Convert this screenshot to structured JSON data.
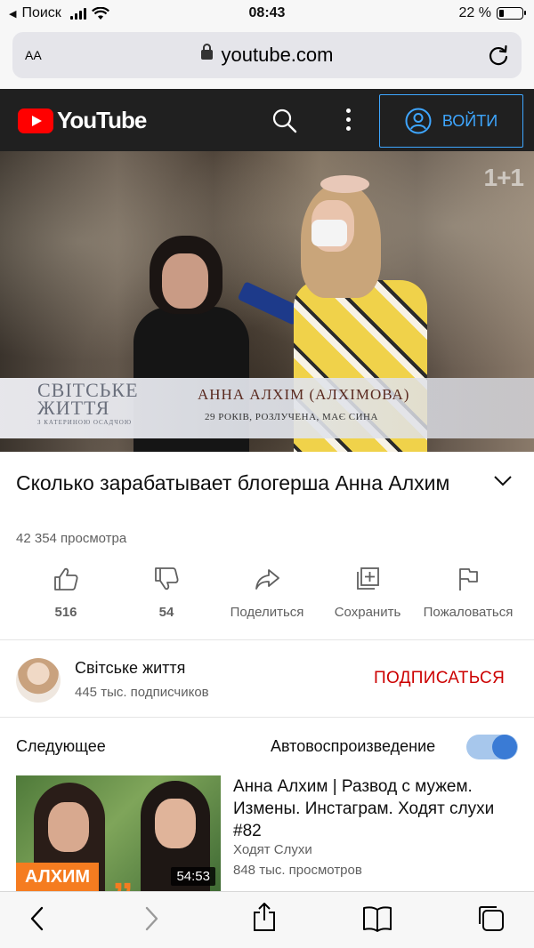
{
  "status_bar": {
    "back_label": "Поиск",
    "time": "08:43",
    "battery": "22 %",
    "battery_level": 0.22
  },
  "browser": {
    "text_size_label": "AA",
    "url": "youtube.com"
  },
  "header": {
    "logo_text": "YouTube",
    "signin_label": "ВОЙТИ",
    "accent_color": "#3ea6ff",
    "brand_color": "#ff0000"
  },
  "video": {
    "overlay": {
      "channel_watermark": "1+1",
      "show_name_line1": "СВІТСЬКЕ",
      "show_name_line2": "ЖИТТЯ",
      "show_name_line3": "З КАТЕРИНОЮ ОСАДЧОЮ",
      "guest_name": "АННА АЛХІМ (АЛХІМОВА)",
      "guest_info": "29 РОКІВ, РОЗЛУЧЕНА, МАЄ СИНА"
    },
    "title": "Сколько зарабатывает блогерша Анна Алхим",
    "views": "42 354 просмотра",
    "actions": [
      {
        "icon": "thumbs-up-icon",
        "label": "516"
      },
      {
        "icon": "thumbs-down-icon",
        "label": "54"
      },
      {
        "icon": "share-icon",
        "label": "Поделиться"
      },
      {
        "icon": "save-to-playlist-icon",
        "label": "Сохранить"
      },
      {
        "icon": "flag-icon",
        "label": "Пожаловаться"
      }
    ]
  },
  "channel": {
    "name": "Світське життя",
    "subscribers": "445 тыс. подписчиков",
    "subscribe_label": "ПОДПИСАТЬСЯ",
    "subscribe_color": "#cc0000"
  },
  "up_next": {
    "title": "Следующее",
    "autoplay_label": "Автовоспроизведение",
    "autoplay_on": true,
    "item": {
      "thumb_tag": "АЛХИМ",
      "thumb_quote": "„",
      "duration": "54:53",
      "title": "Анна Алхим | Развод с мужем. Измены. Инстаграм. Ходят слухи #82",
      "channel": "Ходят Слухи",
      "views": "848 тыс. просмотров"
    }
  }
}
